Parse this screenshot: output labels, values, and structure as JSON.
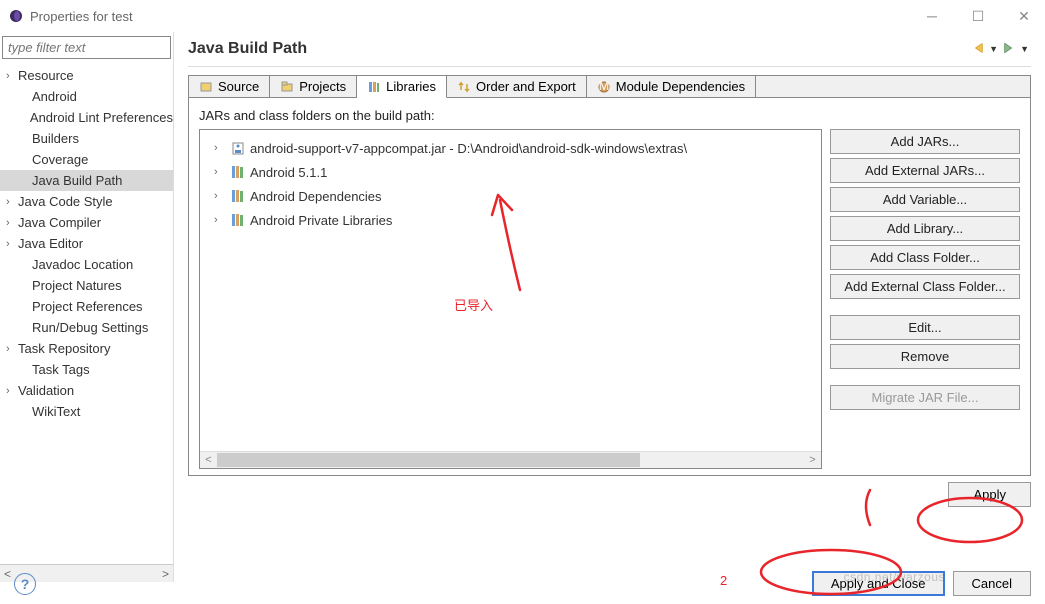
{
  "window": {
    "title": "Properties for test"
  },
  "sidebar": {
    "filter_placeholder": "type filter text",
    "items": [
      {
        "label": "Resource",
        "expandable": true,
        "indented": false
      },
      {
        "label": "Android",
        "expandable": false,
        "indented": true
      },
      {
        "label": "Android Lint Preferences",
        "expandable": false,
        "indented": true
      },
      {
        "label": "Builders",
        "expandable": false,
        "indented": true
      },
      {
        "label": "Coverage",
        "expandable": false,
        "indented": true
      },
      {
        "label": "Java Build Path",
        "expandable": false,
        "indented": true,
        "selected": true
      },
      {
        "label": "Java Code Style",
        "expandable": true,
        "indented": false
      },
      {
        "label": "Java Compiler",
        "expandable": true,
        "indented": false
      },
      {
        "label": "Java Editor",
        "expandable": true,
        "indented": false
      },
      {
        "label": "Javadoc Location",
        "expandable": false,
        "indented": true
      },
      {
        "label": "Project Natures",
        "expandable": false,
        "indented": true
      },
      {
        "label": "Project References",
        "expandable": false,
        "indented": true
      },
      {
        "label": "Run/Debug Settings",
        "expandable": false,
        "indented": true
      },
      {
        "label": "Task Repository",
        "expandable": true,
        "indented": false
      },
      {
        "label": "Task Tags",
        "expandable": false,
        "indented": true
      },
      {
        "label": "Validation",
        "expandable": true,
        "indented": false
      },
      {
        "label": "WikiText",
        "expandable": false,
        "indented": true
      }
    ]
  },
  "content": {
    "title": "Java Build Path",
    "tabs": [
      {
        "label": "Source"
      },
      {
        "label": "Projects"
      },
      {
        "label": "Libraries",
        "active": true
      },
      {
        "label": "Order and Export"
      },
      {
        "label": "Module Dependencies"
      }
    ],
    "section_label": "JARs and class folders on the build path:",
    "libraries": [
      {
        "label": "android-support-v7-appcompat.jar - D:\\Android\\android-sdk-windows\\extras\\",
        "icon": "jar"
      },
      {
        "label": "Android 5.1.1",
        "icon": "lib"
      },
      {
        "label": "Android Dependencies",
        "icon": "lib"
      },
      {
        "label": "Android Private Libraries",
        "icon": "lib"
      }
    ],
    "buttons": {
      "add_jars": "Add JARs...",
      "add_external_jars": "Add External JARs...",
      "add_variable": "Add Variable...",
      "add_library": "Add Library...",
      "add_class_folder": "Add Class Folder...",
      "add_external_class_folder": "Add External Class Folder...",
      "edit": "Edit...",
      "remove": "Remove",
      "migrate": "Migrate JAR File..."
    },
    "apply": "Apply"
  },
  "dialog_buttons": {
    "apply_close": "Apply and Close",
    "cancel": "Cancel"
  },
  "annotation": {
    "text": "已导入",
    "number": "2"
  }
}
